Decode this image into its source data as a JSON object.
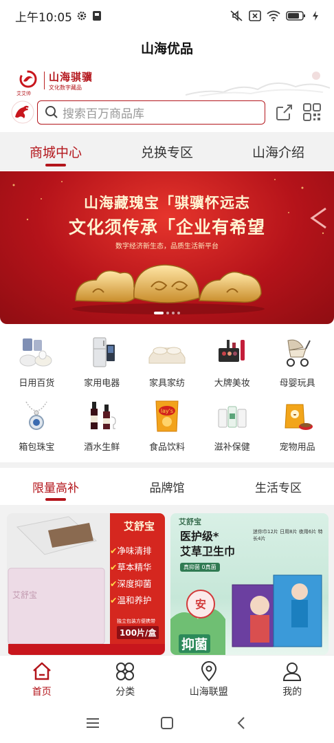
{
  "status_bar": {
    "time": "上午10:05",
    "battery_level": "81"
  },
  "app": {
    "title": "山海优品"
  },
  "brand": {
    "name": "山海骐骥",
    "subtitle": "文化数字藏品",
    "mark_text": "艾艾帅"
  },
  "search": {
    "placeholder": "搜索百万商品库"
  },
  "top_tabs": [
    {
      "label": "商城中心",
      "active": true
    },
    {
      "label": "兑换专区",
      "active": false
    },
    {
      "label": "山海介绍",
      "active": false
    }
  ],
  "banner": {
    "line1": "山海藏瑰宝「骐骥怀远志",
    "line2": "文化须传承「企业有希望",
    "line3": "数字经济新生态，品质生活新平台",
    "slide_count": 4,
    "active_slide": 1
  },
  "categories": [
    {
      "label": "日用百货",
      "icon": "dishware-icon"
    },
    {
      "label": "家用电器",
      "icon": "refrigerator-icon"
    },
    {
      "label": "家具家纺",
      "icon": "bedding-icon"
    },
    {
      "label": "大牌美妆",
      "icon": "cosmetics-icon"
    },
    {
      "label": "母婴玩具",
      "icon": "stroller-icon"
    },
    {
      "label": "箱包珠宝",
      "icon": "necklace-icon"
    },
    {
      "label": "酒水生鲜",
      "icon": "wine-icon"
    },
    {
      "label": "食品饮料",
      "icon": "chips-icon"
    },
    {
      "label": "滋补保健",
      "icon": "supplements-icon"
    },
    {
      "label": "宠物用品",
      "icon": "pet-food-icon"
    }
  ],
  "section_tabs": [
    {
      "label": "限量高补",
      "active": true
    },
    {
      "label": "品牌馆",
      "active": false
    },
    {
      "label": "生活专区",
      "active": false
    }
  ],
  "products": [
    {
      "brand": "艾舒宝",
      "features": [
        "净味清排",
        "草本精华",
        "深度抑菌",
        "温和养护"
      ],
      "note": "独立包装方便携带",
      "quantity": "100片/盒"
    },
    {
      "brand": "艾舒宝",
      "headline1": "医护级*",
      "headline2": "艾草卫生巾",
      "spec": "迷你巾12片 日用8片 夜用6片 特长4片",
      "badge": "真抑菌 0真菌",
      "bottom": "抑菌"
    }
  ],
  "bottom_nav": [
    {
      "label": "首页",
      "icon": "home-icon",
      "active": true
    },
    {
      "label": "分类",
      "icon": "category-icon",
      "active": false
    },
    {
      "label": "山海联盟",
      "icon": "location-pin-icon",
      "active": false
    },
    {
      "label": "我的",
      "icon": "profile-icon",
      "active": false
    }
  ],
  "colors": {
    "brand_red": "#b3151b",
    "banner_gold": "#fff4d2",
    "tab_bg": "#f2f2f2"
  }
}
